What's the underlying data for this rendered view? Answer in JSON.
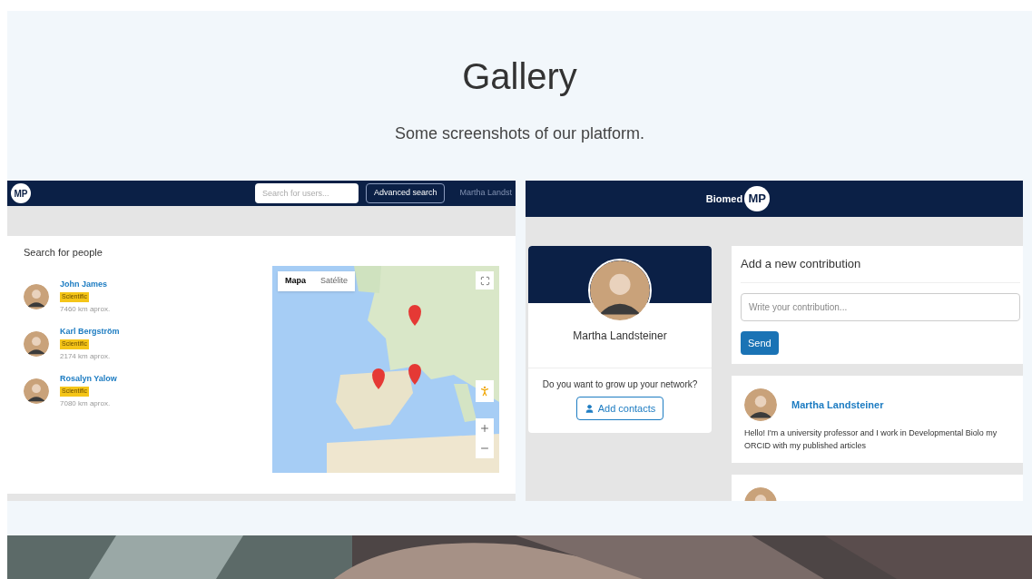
{
  "heading": {
    "title": "Gallery",
    "subtitle": "Some screenshots of our platform."
  },
  "search_screen": {
    "logo": "MP",
    "search": {
      "placeholder": "Search for users..."
    },
    "advanced_button": "Advanced search",
    "user_name": "Martha Landst",
    "panel_title": "Search for people",
    "people": [
      {
        "name": "John James",
        "tag": "Scientific",
        "distance": "7460 km aprox."
      },
      {
        "name": "Karl Bergström",
        "tag": "Scientific",
        "distance": "2174 km aprox."
      },
      {
        "name": "Rosalyn Yalow",
        "tag": "Scientific",
        "distance": "7080 km aprox."
      }
    ],
    "map": {
      "tabs": [
        {
          "label": "Mapa",
          "selected": true
        },
        {
          "label": "Satélite",
          "selected": false
        }
      ]
    }
  },
  "feed_screen": {
    "brand": "Biomed",
    "logo": "MP",
    "profile": {
      "name": "Martha Landsteiner",
      "prompt": "Do you want to grow up your network?",
      "button": "Add contacts"
    },
    "composer": {
      "title": "Add a new contribution",
      "placeholder": "Write your contribution...",
      "button": "Send"
    },
    "posts": [
      {
        "author": "Martha Landsteiner",
        "text": "Hello! I'm a university professor and I work in Developmental Biolo my ORCID with my published articles"
      }
    ]
  }
}
